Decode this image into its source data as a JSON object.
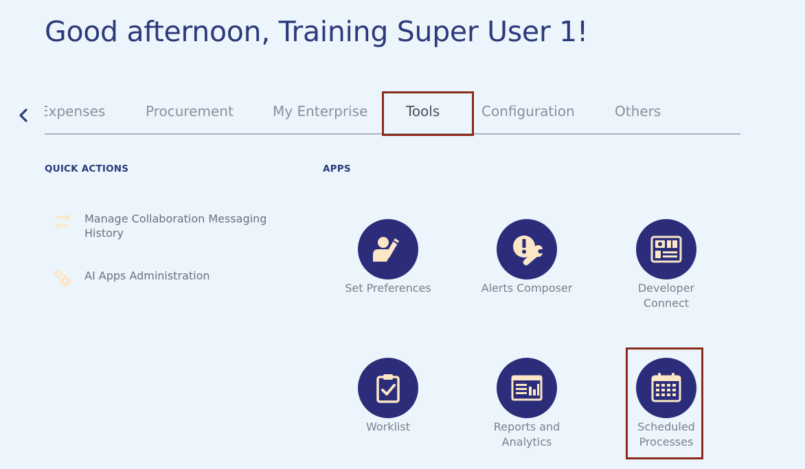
{
  "greeting": "Good afternoon, Training Super User 1!",
  "tabs": [
    {
      "label": "Expenses",
      "state": "partially-visible"
    },
    {
      "label": "Procurement"
    },
    {
      "label": "My Enterprise"
    },
    {
      "label": "Tools",
      "state": "active"
    },
    {
      "label": "Configuration"
    },
    {
      "label": "Others"
    }
  ],
  "quick_actions": {
    "title": "QUICK ACTIONS",
    "items": [
      {
        "label": "Manage Collaboration Messaging History",
        "icon": "swap-arrows-icon"
      },
      {
        "label": "AI Apps Administration",
        "icon": "gears-icon"
      }
    ]
  },
  "apps": {
    "title": "APPS",
    "items": [
      {
        "label": "Set Preferences",
        "icon": "user-edit-icon"
      },
      {
        "label": "Alerts Composer",
        "icon": "alert-wrench-icon"
      },
      {
        "label": "Developer Connect",
        "icon": "developer-dashboard-icon"
      },
      {
        "label": "Worklist",
        "icon": "clipboard-check-icon"
      },
      {
        "label": "Reports and Analytics",
        "icon": "report-chart-icon"
      },
      {
        "label": "Scheduled Processes",
        "icon": "calendar-icon"
      }
    ]
  },
  "colors": {
    "background": "#ecf5fb",
    "primary_text": "#2b3a7a",
    "icon_circle": "#2b2d7b",
    "icon_glyph": "#fbe7c6",
    "highlight_border": "#8b2a1a"
  }
}
